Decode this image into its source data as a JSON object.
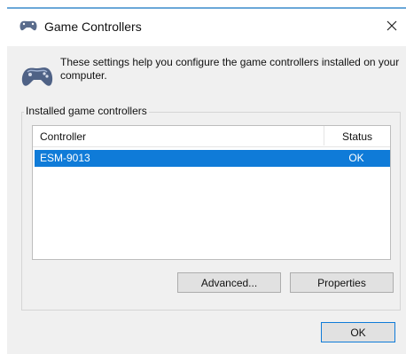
{
  "window": {
    "title": "Game Controllers",
    "close_label": "×"
  },
  "info": {
    "text": "These settings help you configure the game controllers installed on your computer."
  },
  "group": {
    "label": "Installed game controllers"
  },
  "table": {
    "columns": [
      "Controller",
      "Status"
    ],
    "rows": [
      {
        "controller": "ESM-9013",
        "status": "OK",
        "selected": true
      }
    ]
  },
  "buttons": {
    "advanced": "Advanced...",
    "properties": "Properties",
    "ok": "OK"
  },
  "colors": {
    "selection": "#0f7bd8",
    "titlebar_border": "#6aa8d8"
  },
  "icons": {
    "title": "gamepad-icon",
    "info": "gamepad-icon",
    "close": "close-icon"
  }
}
